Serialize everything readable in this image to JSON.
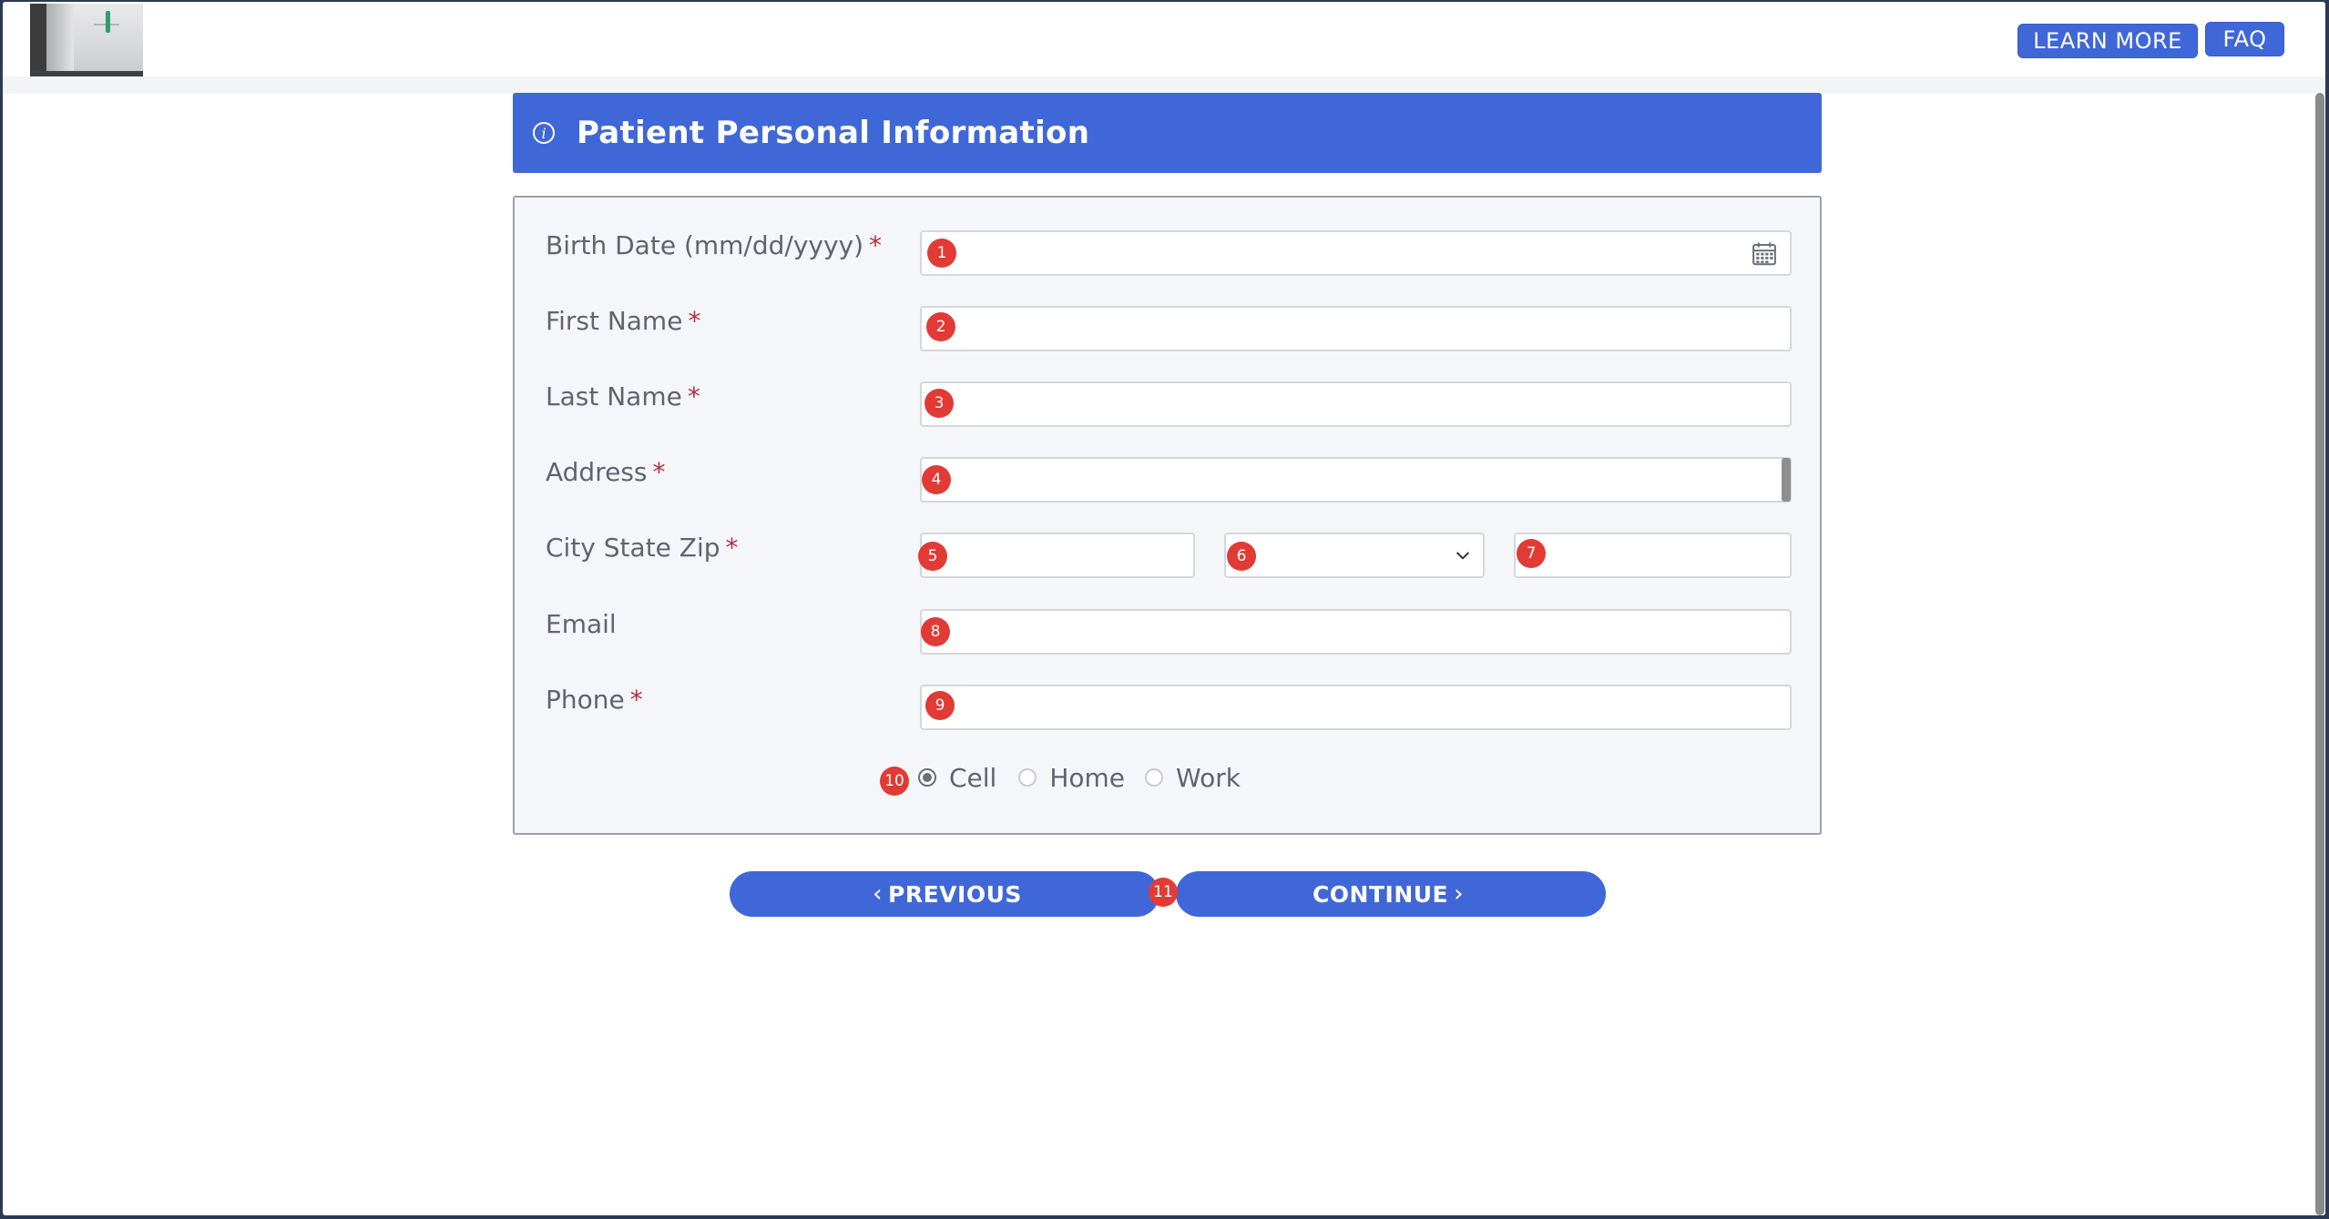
{
  "header": {
    "logo_alt": "doctor-coat-photo",
    "learn_more_label": "LEARN MORE",
    "faq_label": "FAQ"
  },
  "banner": {
    "icon": "info-icon",
    "title": "Patient Personal Information"
  },
  "form": {
    "birth_date": {
      "label": "Birth Date (mm/dd/yyyy)",
      "required_mark": "*",
      "value": "",
      "icon": "calendar-icon",
      "badge": "1"
    },
    "first_name": {
      "label": "First Name",
      "required_mark": "*",
      "value": "",
      "badge": "2"
    },
    "last_name": {
      "label": "Last Name",
      "required_mark": "*",
      "value": "",
      "badge": "3"
    },
    "address": {
      "label": "Address",
      "required_mark": "*",
      "value": "",
      "badge": "4"
    },
    "city_state_zip": {
      "label": "City State Zip",
      "required_mark": "*",
      "city_value": "",
      "city_badge": "5",
      "state_value": "",
      "state_badge": "6",
      "zip_value": "",
      "zip_badge": "7"
    },
    "email": {
      "label": "Email",
      "value": "",
      "badge": "8"
    },
    "phone": {
      "label": "Phone",
      "required_mark": "*",
      "value": "",
      "badge": "9",
      "type_badge": "10",
      "types": [
        {
          "label": "Cell",
          "selected": true
        },
        {
          "label": "Home",
          "selected": false
        },
        {
          "label": "Work",
          "selected": false
        }
      ]
    }
  },
  "nav": {
    "previous_label": "PREVIOUS",
    "continue_label": "CONTINUE",
    "badge": "11"
  },
  "colors": {
    "accent": "#4067d7",
    "badge": "#e23a35",
    "required": "#b23045"
  }
}
